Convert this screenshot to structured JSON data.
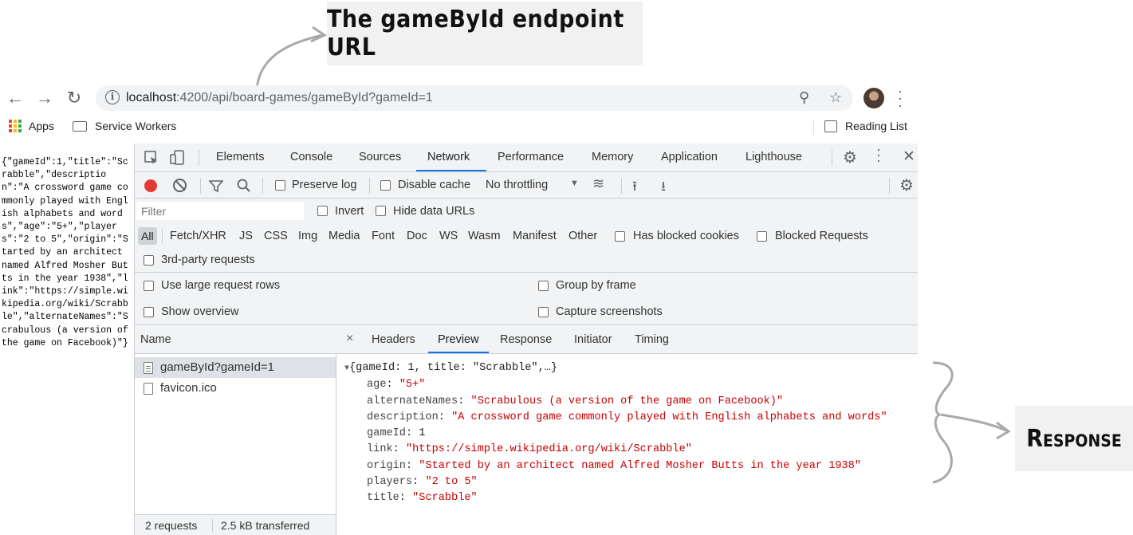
{
  "annotations": {
    "top_label": "The gameById endpoint URL",
    "right_label": "Response"
  },
  "browser": {
    "url_host": "localhost",
    "url_path": ":4200/api/board-games/gameById?gameId=1",
    "icons": [
      "back-arrow-icon",
      "forward-arrow-icon",
      "reload-icon",
      "info-icon",
      "zoom-icon",
      "star-icon",
      "avatar",
      "kebab-menu-icon"
    ],
    "bookmarks": {
      "apps": "Apps",
      "service_workers": "Service Workers",
      "reading_list": "Reading List"
    }
  },
  "raw_json": "{\"gameId\":1,\"title\":\"Scrabble\",\"description\":\"A crossword game commonly played with English alphabets and words\",\"age\":\"5+\",\"players\":\"2 to 5\",\"origin\":\"Started by an architect named Alfred Mosher Butts in the year 1938\",\"link\":\"https://simple.wikipedia.org/wiki/Scrabble\",\"alternateNames\":\"Scrabulous (a version of the game on Facebook)\"}",
  "devtools": {
    "tabs": [
      "Elements",
      "Console",
      "Sources",
      "Network",
      "Performance",
      "Memory",
      "Application",
      "Lighthouse"
    ],
    "active_tab": "Network",
    "toolbar": {
      "preserve_log": "Preserve log",
      "disable_cache": "Disable cache",
      "throttling": "No throttling"
    },
    "filter": {
      "placeholder": "Filter",
      "invert": "Invert",
      "hide_data_urls": "Hide data URLs"
    },
    "types": [
      "All",
      "Fetch/XHR",
      "JS",
      "CSS",
      "Img",
      "Media",
      "Font",
      "Doc",
      "WS",
      "Wasm",
      "Manifest",
      "Other"
    ],
    "has_blocked_cookies": "Has blocked cookies",
    "blocked_requests": "Blocked Requests",
    "third_party": "3rd-party requests",
    "settings": {
      "large_rows": "Use large request rows",
      "group_by_frame": "Group by frame",
      "show_overview": "Show overview",
      "capture_screenshots": "Capture screenshots"
    },
    "name_header": "Name",
    "requests": [
      "gameById?gameId=1",
      "favicon.ico"
    ],
    "status": {
      "requests": "2 requests",
      "transferred": "2.5 kB transferred"
    },
    "detail_tabs": [
      "Headers",
      "Preview",
      "Response",
      "Initiator",
      "Timing"
    ],
    "active_detail_tab": "Preview",
    "preview": {
      "summary": "{gameId: 1, title: \"Scrabble\",…}",
      "fields": [
        {
          "key": "age",
          "value": "\"5+\"",
          "kind": "string"
        },
        {
          "key": "alternateNames",
          "value": "\"Scrabulous (a version of the game on Facebook)\"",
          "kind": "string"
        },
        {
          "key": "description",
          "value": "\"A crossword game commonly played with English alphabets and words\"",
          "kind": "string"
        },
        {
          "key": "gameId",
          "value": "1",
          "kind": "number"
        },
        {
          "key": "link",
          "value": "\"https://simple.wikipedia.org/wiki/Scrabble\"",
          "kind": "string"
        },
        {
          "key": "origin",
          "value": "\"Started by an architect named Alfred Mosher Butts in the year 1938\"",
          "kind": "string"
        },
        {
          "key": "players",
          "value": "\"2 to 5\"",
          "kind": "string"
        },
        {
          "key": "title",
          "value": "\"Scrabble\"",
          "kind": "string"
        }
      ]
    }
  }
}
